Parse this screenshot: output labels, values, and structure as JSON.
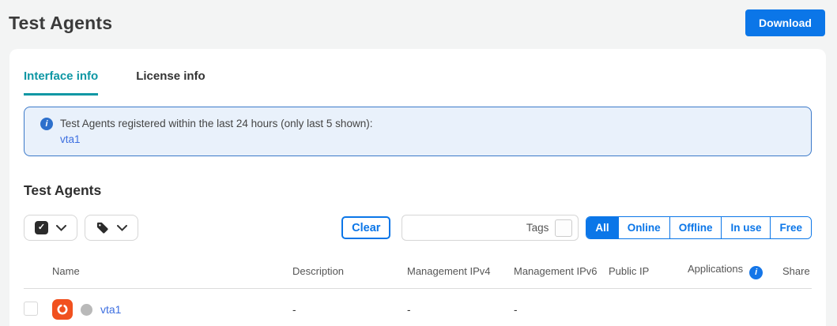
{
  "page": {
    "title": "Test Agents"
  },
  "header": {
    "download_label": "Download"
  },
  "tabs": [
    {
      "label": "Interface info",
      "active": true
    },
    {
      "label": "License info",
      "active": false
    }
  ],
  "banner": {
    "text": "Test Agents registered within the last 24 hours (only last 5 shown):",
    "link": "vta1"
  },
  "section": {
    "title": "Test Agents"
  },
  "toolbar": {
    "clear_label": "Clear",
    "tags_label": "Tags",
    "filters": [
      "All",
      "Online",
      "Offline",
      "In use",
      "Free"
    ],
    "active_filter": "All"
  },
  "table": {
    "headers": [
      "Name",
      "Description",
      "Management IPv4",
      "Management IPv6",
      "Public IP",
      "Applications",
      "Share"
    ],
    "rows": [
      {
        "name": "vta1",
        "status": "offline",
        "description": "-",
        "management_ipv4": "-",
        "management_ipv6": "-",
        "public_ip": "",
        "applications": "",
        "share": ""
      }
    ]
  },
  "icons": {
    "info": "i",
    "check": "✓"
  },
  "colors": {
    "primary_blue": "#0b76e8",
    "tab_teal": "#0e97a4",
    "banner_bg": "#e9f1fb",
    "banner_border": "#3b79c9",
    "link_blue": "#3d6fe0",
    "agent_icon_orange": "#f1511f",
    "status_gray": "#b9b9b9"
  }
}
